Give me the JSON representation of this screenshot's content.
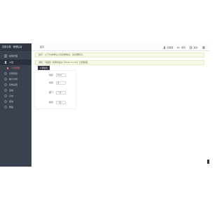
{
  "sidebar": {
    "title": "拉取记录 · 管理后台",
    "items": [
      {
        "icon": "menu-icon",
        "label": "权限管理",
        "state": "normal"
      },
      {
        "icon": "user-icon",
        "label": "人员",
        "state": "active"
      },
      {
        "icon": "dot-icon",
        "label": "人员管理",
        "state": "sub"
      },
      {
        "icon": "circle-icon",
        "label": "记录列表",
        "state": "normal"
      },
      {
        "icon": "circle-icon",
        "label": "统计分析",
        "state": "normal"
      },
      {
        "icon": "circle-icon",
        "label": "系统设置",
        "state": "normal"
      },
      {
        "icon": "circle-icon",
        "label": "设备",
        "state": "normal"
      },
      {
        "icon": "circle-icon",
        "label": "日志",
        "state": "normal"
      },
      {
        "icon": "circle-icon",
        "label": "其他",
        "state": "normal"
      },
      {
        "icon": "circle-icon",
        "label": "帮助",
        "state": "normal"
      }
    ]
  },
  "topbar": {
    "breadcrumb": "首页",
    "actions": [
      {
        "icon": "user-icon",
        "label": "管理员"
      },
      {
        "icon": "key-icon",
        "label": "密码"
      },
      {
        "icon": "logout-icon",
        "label": "退出"
      },
      {
        "icon": "gear-icon",
        "label": ""
      }
    ]
  },
  "notices": [
    "提示：以下为本单位人员名单信息，请仔细核对。",
    "通知：【提醒】请按时提交【2020-07-01】记录数据。"
  ],
  "add_button": "人员信息",
  "form": [
    {
      "label": "姓名",
      "value": "Rose"
    },
    {
      "label": "性别",
      "value": "女"
    },
    {
      "label": "部门",
      "value": "一部"
    },
    {
      "label": "职务",
      "value": "一般"
    }
  ]
}
